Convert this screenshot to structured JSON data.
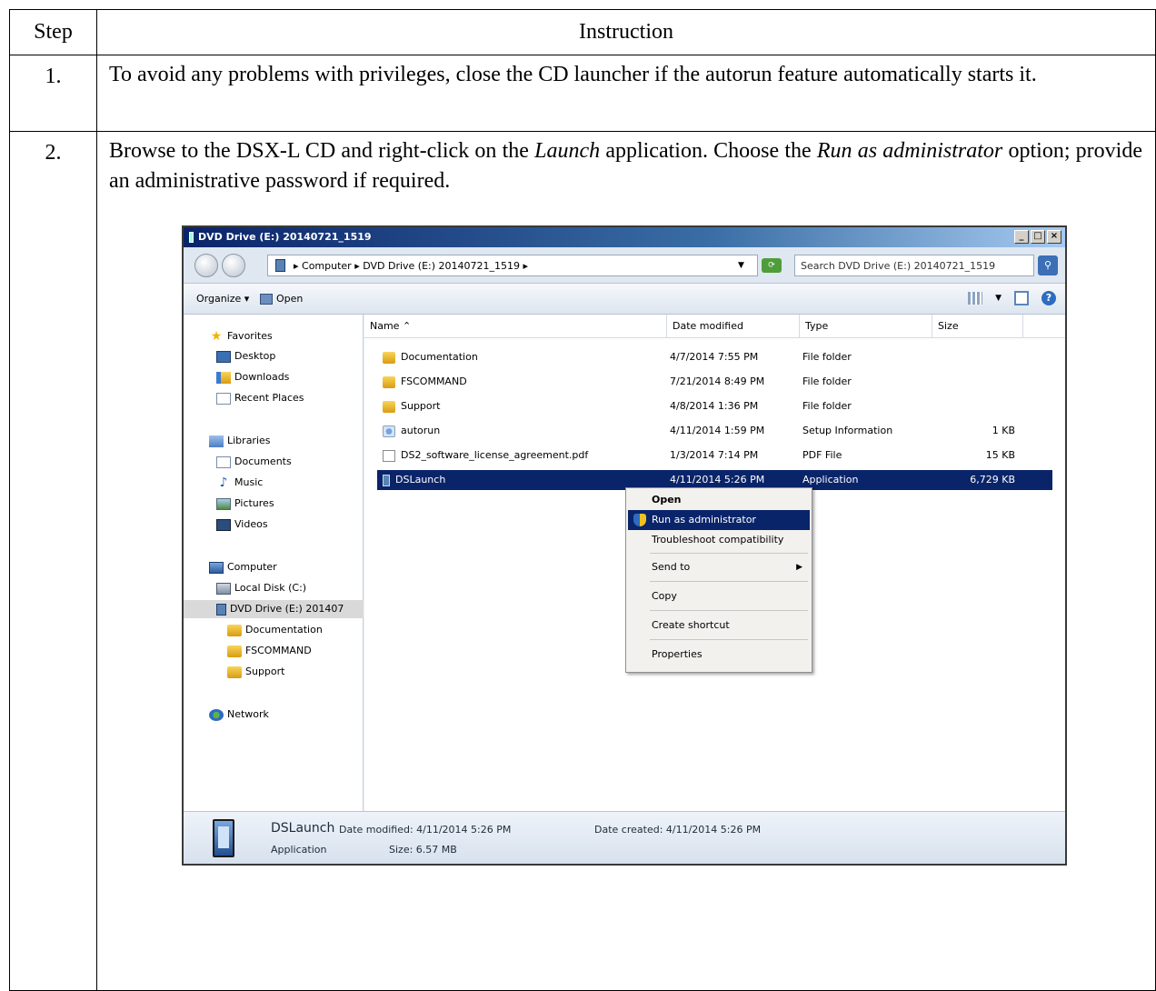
{
  "table": {
    "header_step": "Step",
    "header_instruction": "Instruction",
    "rows": [
      {
        "step": "1.",
        "text": "To avoid any problems with privileges, close the CD launcher if the autorun feature automatically starts it."
      },
      {
        "step": "2.",
        "text_part1": "Browse to the DSX-L CD and right-click on the ",
        "text_italic1": "Launch",
        "text_part2": " application.  Choose the ",
        "text_italic2": "Run as administrator",
        "text_part3": " option; provide an administrative password if required."
      }
    ]
  },
  "explorer": {
    "title": "DVD Drive (E:) 20140721_1519",
    "window_buttons": [
      "_",
      "□",
      "×"
    ],
    "address": "▸ Computer ▸ DVD Drive (E:) 20140721_1519 ▸",
    "search_placeholder": "Search DVD Drive (E:) 20140721_1519",
    "toolbar": {
      "organize": "Organize ▾",
      "open": "Open"
    },
    "nav": {
      "favorites": "Favorites",
      "desktop": "Desktop",
      "downloads": "Downloads",
      "recent": "Recent Places",
      "libraries": "Libraries",
      "documents": "Documents",
      "music": "Music",
      "pictures": "Pictures",
      "videos": "Videos",
      "computer": "Computer",
      "local_disk": "Local Disk (C:)",
      "dvd_drive": "DVD Drive (E:) 201407",
      "sub_documentation": "Documentation",
      "sub_fscommand": "FSCOMMAND",
      "sub_support": "Support",
      "network": "Network"
    },
    "columns": {
      "name": "Name ⌃",
      "date": "Date modified",
      "type": "Type",
      "size": "Size"
    },
    "files": [
      {
        "name": "Documentation",
        "date": "4/7/2014 7:55 PM",
        "type": "File folder",
        "size": ""
      },
      {
        "name": "FSCOMMAND",
        "date": "7/21/2014 8:49 PM",
        "type": "File folder",
        "size": ""
      },
      {
        "name": "Support",
        "date": "4/8/2014 1:36 PM",
        "type": "File folder",
        "size": ""
      },
      {
        "name": "autorun",
        "date": "4/11/2014 1:59 PM",
        "type": "Setup Information",
        "size": "1 KB"
      },
      {
        "name": "DS2_software_license_agreement.pdf",
        "date": "1/3/2014 7:14 PM",
        "type": "PDF File",
        "size": "15 KB"
      },
      {
        "name": "DSLaunch",
        "date": "4/11/2014 5:26 PM",
        "type": "Application",
        "size": "6,729 KB"
      }
    ],
    "context_menu": {
      "open": "Open",
      "run_as_admin": "Run as administrator",
      "troubleshoot": "Troubleshoot compatibility",
      "send_to": "Send to",
      "copy": "Copy",
      "create_shortcut": "Create shortcut",
      "properties": "Properties"
    },
    "details": {
      "name": "DSLaunch",
      "date_modified": "Date modified: 4/11/2014 5:26 PM",
      "date_created": "Date created: 4/11/2014 5:26 PM",
      "type": "Application",
      "size": "Size: 6.57 MB"
    }
  }
}
